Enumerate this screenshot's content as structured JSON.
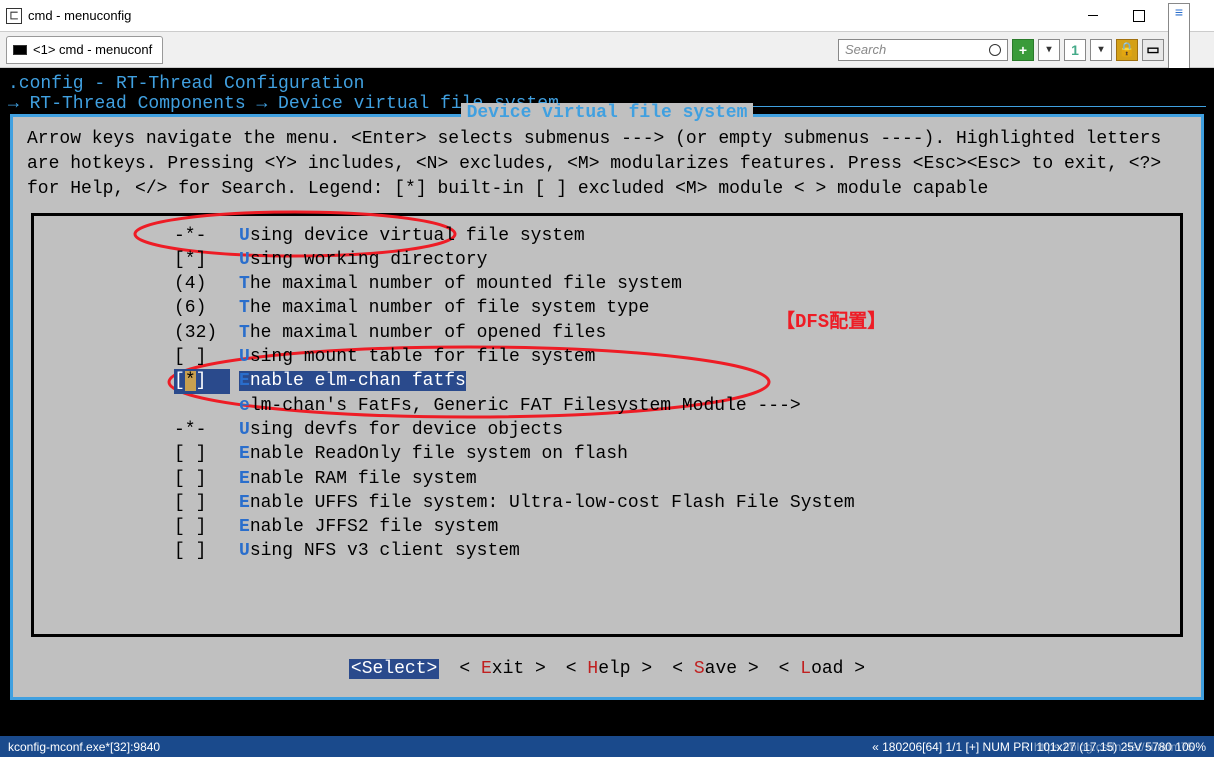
{
  "window": {
    "title": "cmd - menuconfig"
  },
  "tab": {
    "label": "<1> cmd - menuconf"
  },
  "search": {
    "placeholder": "Search"
  },
  "configfile": ".config - RT-Thread Configuration",
  "breadcrumb": "→ RT-Thread Components → Device virtual file system",
  "panel_title": "Device virtual file system",
  "helptext": "Arrow keys navigate the menu.  <Enter> selects submenus ---> (or empty submenus ----). Highlighted letters are hotkeys.  Pressing <Y> includes, <N> excludes, <M> modularizes features.  Press <Esc><Esc> to exit, <?> for Help, </> for Search.  Legend: [*] built-in [ ] excluded  <M> module  < > module capable",
  "annotation": "【DFS配置】",
  "items": [
    {
      "bracket": "-*-",
      "hotkey": "U",
      "label": "sing device virtual file system"
    },
    {
      "bracket": "[*]",
      "hotkey": "U",
      "label": "sing working directory",
      "indent": 1
    },
    {
      "bracket": "(4)",
      "hotkey": "T",
      "label": "he maximal number of mounted file system",
      "indent": 1
    },
    {
      "bracket": "(6)",
      "hotkey": "T",
      "label": "he maximal number of file system type",
      "indent": 1
    },
    {
      "bracket": "(32)",
      "hotkey": "T",
      "label": "he maximal number of opened files",
      "indent": 1
    },
    {
      "bracket": "[ ]",
      "hotkey": "U",
      "label": "sing mount table for file system"
    },
    {
      "bracket": "[*]",
      "hotkey": "E",
      "label": "nable elm-chan fatfs",
      "selected": true
    },
    {
      "bracket": "   ",
      "hotkey": "e",
      "label": "lm-chan's FatFs, Generic FAT Filesystem Module  --->",
      "indent": 1,
      "submenu": true
    },
    {
      "bracket": "-*-",
      "hotkey": "U",
      "label": "sing devfs for device objects"
    },
    {
      "bracket": "[ ]",
      "hotkey": "E",
      "label": "nable ReadOnly file system on flash"
    },
    {
      "bracket": "[ ]",
      "hotkey": "E",
      "label": "nable RAM file system"
    },
    {
      "bracket": "[ ]",
      "hotkey": "E",
      "label": "nable UFFS file system: Ultra-low-cost Flash File System"
    },
    {
      "bracket": "[ ]",
      "hotkey": "E",
      "label": "nable JFFS2 file system"
    },
    {
      "bracket": "[ ]",
      "hotkey": "U",
      "label": "sing NFS v3 client system"
    }
  ],
  "buttons": {
    "select": "Select",
    "exit": "Exit",
    "help": "Help",
    "save": "Save",
    "load": "Load"
  },
  "statusbar": {
    "filename": "kconfig-mconf.exe*[32]:9840",
    "info": "« 180206[64]  1/1  [+] NUM   PRI   101x27   (17,15) 25V   5780  100%"
  },
  "watermark": "https://blog.csdn.net/sundm75"
}
